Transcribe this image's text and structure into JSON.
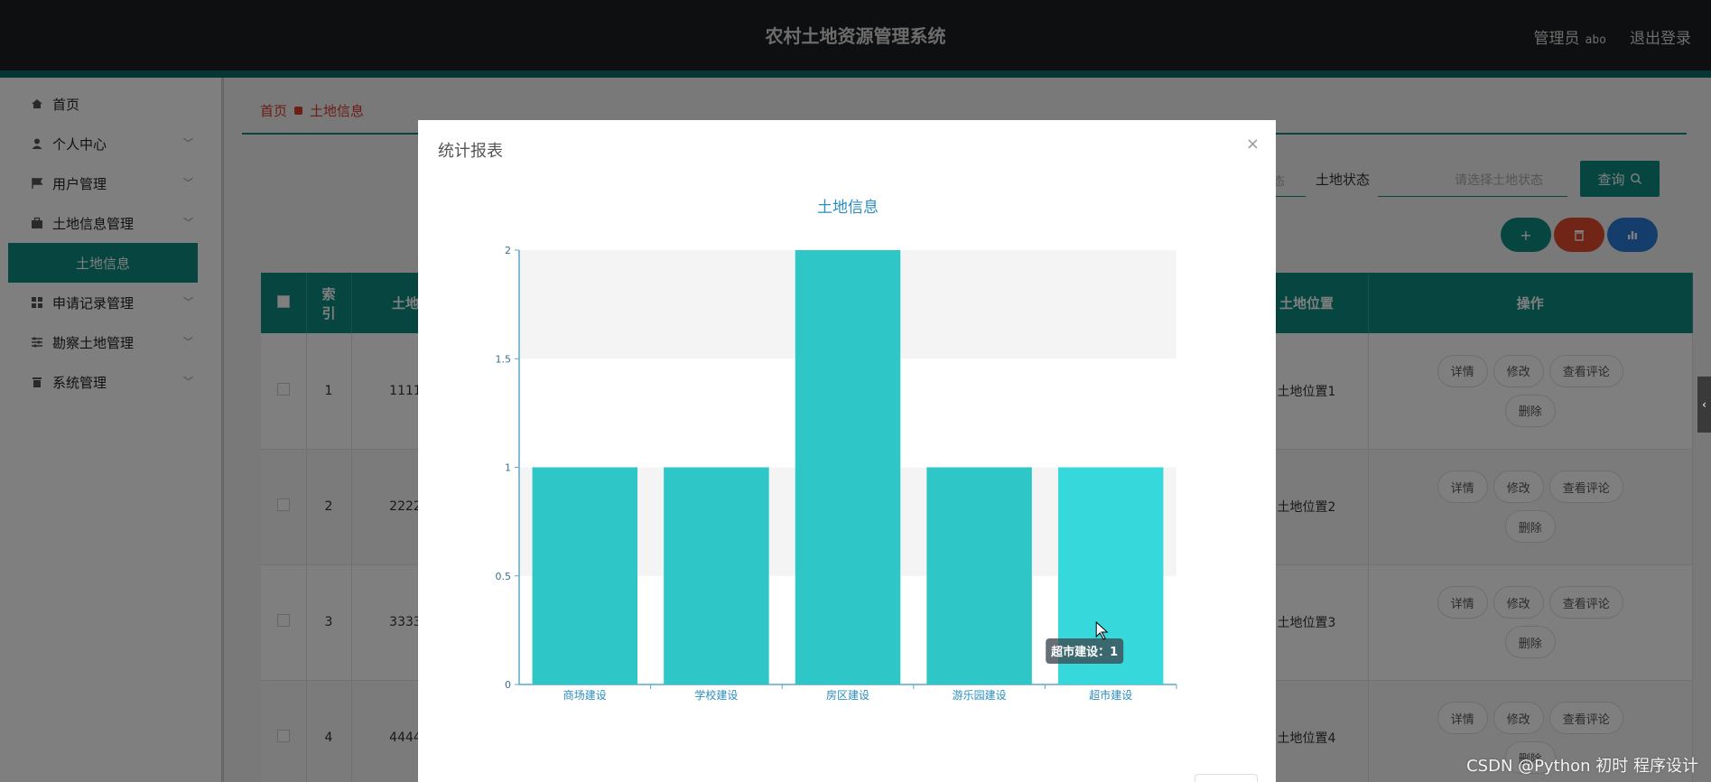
{
  "header": {
    "title": "农村土地资源管理系统",
    "role_label": "管理员",
    "username": "abo",
    "logout_label": "退出登录"
  },
  "sidebar": {
    "items": [
      {
        "label": "首页",
        "icon": "home-icon"
      },
      {
        "label": "个人中心",
        "icon": "person-icon"
      },
      {
        "label": "用户管理",
        "icon": "flag-icon"
      },
      {
        "label": "土地信息管理",
        "icon": "briefcase-icon"
      },
      {
        "label": "申请记录管理",
        "icon": "grid-icon"
      },
      {
        "label": "勘察土地管理",
        "icon": "sliders-icon"
      },
      {
        "label": "系统管理",
        "icon": "trash-icon"
      }
    ],
    "active_sub": "土地信息"
  },
  "breadcrumb": {
    "home": "首页",
    "current": "土地信息"
  },
  "filters": {
    "partial_text": "态",
    "status_label": "土地状态",
    "status_placeholder": "请选择土地状态",
    "query_label": "查询"
  },
  "action_buttons": {
    "add": "+",
    "delete": "delete-icon",
    "chart": "chart-icon"
  },
  "table": {
    "headers": {
      "index": "索\n引",
      "name": "土地",
      "location": "土地位置",
      "actions": "操作"
    },
    "rows": [
      {
        "index": "1",
        "name": "1111",
        "location": "土地位置1"
      },
      {
        "index": "2",
        "name": "2222",
        "location": "土地位置2"
      },
      {
        "index": "3",
        "name": "3333",
        "location": "土地位置3"
      },
      {
        "index": "4",
        "name": "4444",
        "location": "土地位置4"
      }
    ],
    "ops": {
      "detail": "详情",
      "edit": "修改",
      "comments": "查看评论",
      "delete": "删除"
    }
  },
  "modal": {
    "title": "统计报表",
    "close": "×"
  },
  "chart_data": {
    "type": "bar",
    "title": "土地信息",
    "categories": [
      "商场建设",
      "学校建设",
      "房区建设",
      "游乐园建设",
      "超市建设"
    ],
    "values": [
      1,
      1,
      2,
      1,
      1
    ],
    "ylim": [
      0,
      2
    ],
    "yticks": [
      "0",
      "0.5",
      "1",
      "1.5",
      "2"
    ],
    "bar_color": "#2ec6c6",
    "highlight_color": "#37d8dc",
    "tooltip": "超市建设：1",
    "grid": true
  },
  "colors": {
    "accent": "#0e8a80",
    "danger": "#e04a2f",
    "info": "#2a7bd6",
    "header_bg": "#1d1e20"
  },
  "watermark": "CSDN @Python 初时 程序设计"
}
